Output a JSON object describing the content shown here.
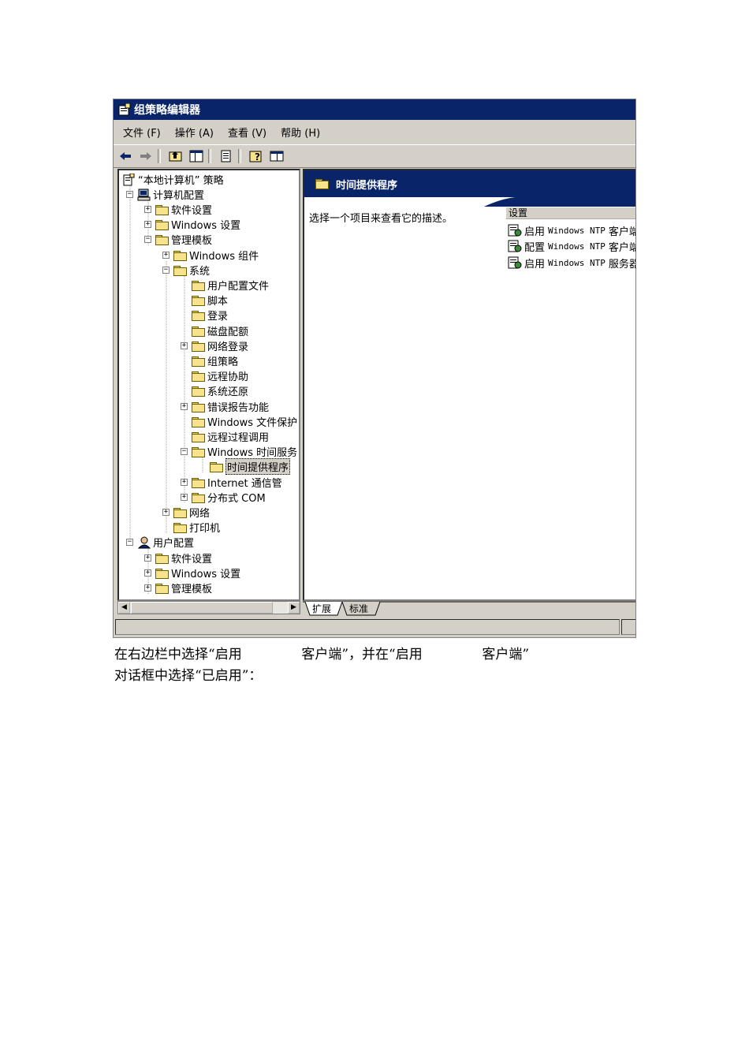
{
  "window": {
    "title": "组策略编辑器",
    "menu": [
      "文件 (F)",
      "操作 (A)",
      "查看 (V)",
      "帮助 (H)"
    ],
    "toolbar_icons": [
      "back-arrow-icon",
      "forward-arrow-icon",
      "up-folder-icon",
      "show-tree-icon",
      "export-list-icon",
      "help-icon",
      "properties-icon"
    ]
  },
  "tree": {
    "root": "“本地计算机” 策略",
    "computer_config": "计算机配置",
    "cc_software": "软件设置",
    "cc_windows": "Windows 设置",
    "cc_admin": "管理模板",
    "windows_components": "Windows 组件",
    "system": "系统",
    "user_profiles": "用户配置文件",
    "scripts": "脚本",
    "logon": "登录",
    "disk_quota": "磁盘配额",
    "net_logon": "网络登录",
    "group_policy": "组策略",
    "remote_assist": "远程协助",
    "system_restore": "系统还原",
    "error_reporting": "错误报告功能",
    "file_protection": "Windows 文件保护",
    "rpc": "远程过程调用",
    "time_service": "Windows 时间服务",
    "time_providers": "时间提供程序",
    "internet_comm": "Internet 通信管",
    "dcom": "分布式 COM",
    "network": "网络",
    "printers": "打印机",
    "user_config": "用户配置",
    "uc_software": "软件设置",
    "uc_windows": "Windows 设置",
    "uc_admin": "管理模板"
  },
  "right_pane": {
    "header": "时间提供程序",
    "description": "选择一个项目来查看它的描述。",
    "column": "设置",
    "items": [
      {
        "prefix": "启用",
        "mono": "Windows NTP",
        "suffix": "客户端"
      },
      {
        "prefix": "配置",
        "mono": "Windows NTP",
        "suffix": "客户端"
      },
      {
        "prefix": "启用",
        "mono": "Windows NTP",
        "suffix": "服务器"
      }
    ]
  },
  "tabs": [
    "扩展",
    "标准"
  ],
  "caption": {
    "line1": "在右边栏中选择“启用              客户端”，并在“启用              客户端”",
    "line2": "对话框中选择“已启用”："
  }
}
